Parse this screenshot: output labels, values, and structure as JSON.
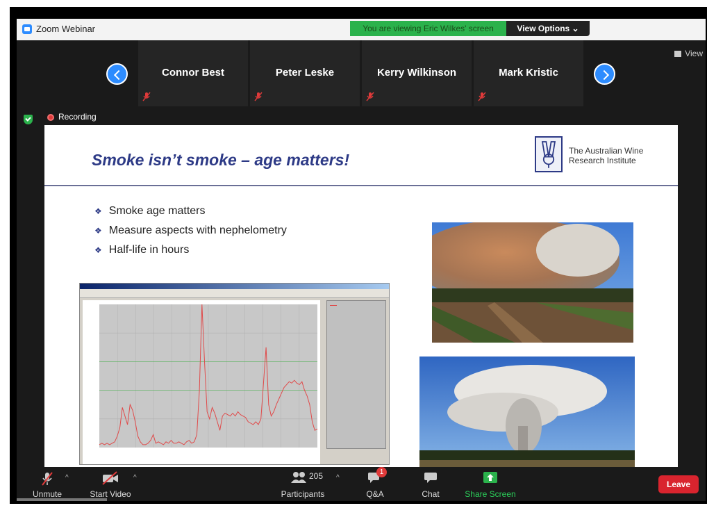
{
  "window": {
    "app_title": "Zoom Webinar",
    "share_banner": "You are viewing Eric Wilkes' screen",
    "view_options": "View Options ⌄",
    "view_button": "View"
  },
  "gallery": {
    "participants": [
      {
        "name": "Connor Best"
      },
      {
        "name": "Peter Leske"
      },
      {
        "name": "Kerry Wilkinson"
      },
      {
        "name": "Mark Kristic"
      }
    ]
  },
  "recording": {
    "label": "Recording"
  },
  "slide": {
    "title": "Smoke isn’t smoke – age matters!",
    "logo_line1": "The Australian Wine",
    "logo_line2": "Research Institute",
    "bullets": [
      "Smoke age matters",
      "Measure aspects with nephelometry",
      "Half-life in hours"
    ]
  },
  "chart_data": {
    "type": "line",
    "series": [
      {
        "values": [
          2,
          3,
          2,
          3,
          2,
          3,
          4,
          8,
          14,
          28,
          22,
          16,
          30,
          26,
          18,
          8,
          4,
          2,
          2,
          3,
          5,
          9,
          3,
          4,
          3,
          2,
          4,
          3,
          5,
          3,
          3,
          4,
          3,
          2,
          4,
          5,
          3,
          4,
          9,
          40,
          100,
          60,
          25,
          20,
          28,
          24,
          18,
          12,
          22,
          24,
          23,
          22,
          24,
          22,
          25,
          23,
          22,
          21,
          18,
          17,
          16,
          18,
          16,
          20,
          45,
          70,
          30,
          22,
          25,
          30,
          34,
          38,
          42,
          44,
          46,
          45,
          47,
          45,
          44,
          46,
          40,
          36,
          30,
          18,
          12,
          13
        ]
      }
    ],
    "line_color": "#e04a4a"
  },
  "toolbar": {
    "unmute": "Unmute",
    "start_video": "Start Video",
    "participants_count": "205",
    "participants": "Participants",
    "qa": "Q&A",
    "qa_badge": "1",
    "chat": "Chat",
    "share_screen": "Share Screen",
    "leave": "Leave"
  },
  "colors": {
    "accent": "#2d8cff",
    "share_green": "#2bb24c",
    "leave_red": "#d9242e",
    "slide_title": "#2d3a86"
  }
}
